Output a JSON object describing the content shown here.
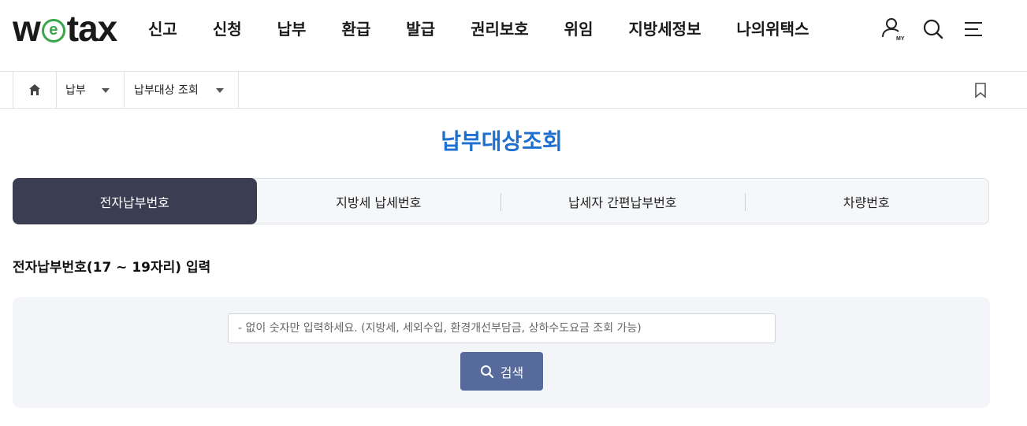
{
  "header": {
    "logo": {
      "w": "w",
      "e": "e",
      "tax": "tax"
    },
    "nav": [
      "신고",
      "신청",
      "납부",
      "환급",
      "발급",
      "권리보호",
      "위임",
      "지방세정보",
      "나의위택스"
    ],
    "icons": [
      "my-page-icon",
      "search-icon",
      "menu-icon"
    ],
    "my_label": "MY"
  },
  "breadcrumb": {
    "home_icon": "home-icon",
    "level1": "납부",
    "level2": "납부대상 조회",
    "bookmark_icon": "bookmark-icon"
  },
  "page": {
    "title": "납부대상조회",
    "tabs": [
      {
        "label": "전자납부번호",
        "active": true
      },
      {
        "label": "지방세 납세번호",
        "active": false
      },
      {
        "label": "납세자 간편납부번호",
        "active": false
      },
      {
        "label": "차량번호",
        "active": false
      }
    ],
    "section_label": "전자납부번호(17 ~ 19자리) 입력",
    "search": {
      "value": "",
      "placeholder": "- 없이 숫자만 입력하세요. (지방세, 세외수입, 환경개선부담금, 상하수도요금 조회 가능)",
      "button_label": "검색"
    }
  },
  "colors": {
    "title_blue": "#1f6fd1",
    "active_tab": "#3b3d52",
    "search_button": "#566a9c",
    "logo_green": "#3aa54a"
  }
}
